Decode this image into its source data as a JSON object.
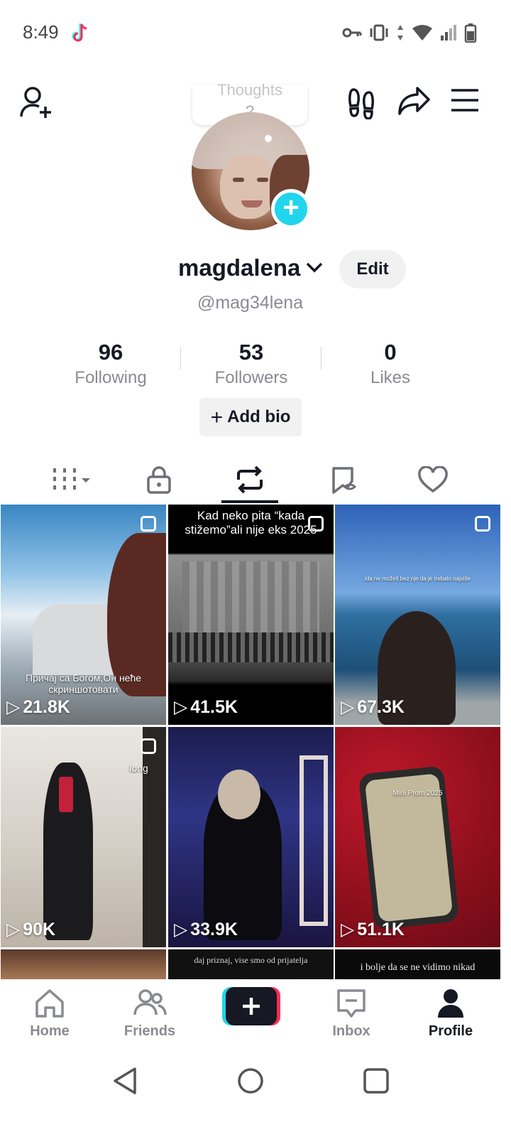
{
  "status_bar": {
    "time": "8:49",
    "icons": [
      "tiktok-icon",
      "key-icon",
      "vibrate-icon",
      "data-arrows-icon",
      "wifi-icon",
      "signal-icon",
      "battery-icon"
    ]
  },
  "header": {
    "icons": [
      "add-friend-icon",
      "footprints-icon",
      "share-icon",
      "menu-icon"
    ]
  },
  "note_tip": {
    "line1": "Thoughts",
    "line2": "?"
  },
  "profile": {
    "username": "magdalena",
    "handle": "@mag34lena",
    "edit_label": "Edit",
    "add_bio_label": "Add bio"
  },
  "stats": [
    {
      "value": "96",
      "label": "Following"
    },
    {
      "value": "53",
      "label": "Followers"
    },
    {
      "value": "0",
      "label": "Likes"
    }
  ],
  "tabs": [
    "videos-grid-icon",
    "lock-icon",
    "repost-icon",
    "favorites-icon",
    "heart-icon"
  ],
  "active_tab": "repost",
  "videos": [
    {
      "views": "21.8K",
      "caption": "Причај са Богом,Он неће скриншотовати"
    },
    {
      "views": "41.5K",
      "caption": "Kad neko pita “kada stižemo”ali nije eks 2025"
    },
    {
      "views": "67.3K",
      "caption": "ida ne možeš bez nje da je trebalo najviše"
    },
    {
      "views": "90K",
      "caption": "long"
    },
    {
      "views": "33.9K",
      "caption": ""
    },
    {
      "views": "51.1K",
      "caption": "Mini Prom 2025"
    },
    {
      "views": "",
      "caption": ""
    },
    {
      "views": "",
      "caption": "daj priznaj, vise smo od prijatelja"
    },
    {
      "views": "",
      "caption": "i bolje da se ne vidimo nikad"
    }
  ],
  "bottom_nav": {
    "home": "Home",
    "friends": "Friends",
    "inbox": "Inbox",
    "profile": "Profile"
  },
  "colors": {
    "accent_cyan": "#20d5ec",
    "accent_red": "#fe2c55",
    "text": "#161823",
    "muted": "#8a8b91"
  }
}
